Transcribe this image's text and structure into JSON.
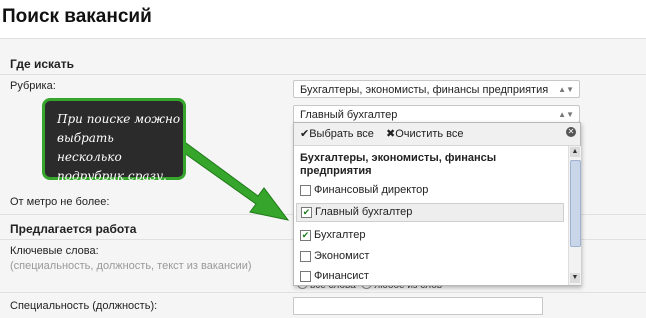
{
  "page_title": "Поиск вакансий",
  "section_where": "Где искать",
  "rubric_label": "Рубрика:",
  "rubric_select": "Бухгалтеры, экономисты, финансы предприятия",
  "subrubric_select": "Главный бухгалтер",
  "metro_label": "От метро не более:",
  "section_offer": "Предлагается работа",
  "keywords_label": "Ключевые слова:",
  "keywords_hint": "(специальность, должность, текст из вакансии)",
  "radio_all": "все слова",
  "radio_any": "любое из слов",
  "specialty_label": "Специальность (должность):",
  "dropdown": {
    "select_all": "Выбрать все",
    "clear_all": "Очистить все",
    "group": "Бухгалтеры, экономисты, финансы предприятия",
    "options": [
      {
        "label": "Финансовый директор",
        "checked": false
      },
      {
        "label": "Главный бухгалтер",
        "checked": true
      },
      {
        "label": "Бухгалтер",
        "checked": true
      },
      {
        "label": "Экономист",
        "checked": false
      },
      {
        "label": "Финансист",
        "checked": false
      }
    ]
  },
  "callout_text": "При поиске можно выбрать несколько подрубрик сразу.",
  "colors": {
    "callout_border": "#35a52b",
    "callout_bg": "#2b2b2b",
    "arrow": "#35a52b"
  }
}
